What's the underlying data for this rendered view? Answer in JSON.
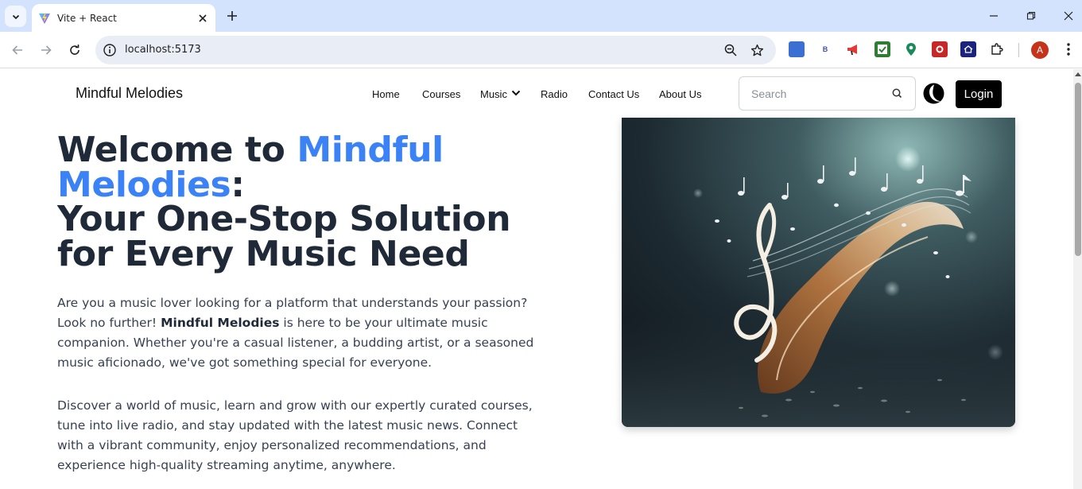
{
  "browser": {
    "tab_title": "Vite + React",
    "url": "localhost:5173",
    "profile_initial": "A",
    "extension_b_label": "B"
  },
  "site": {
    "brand": "Mindful Melodies",
    "nav": {
      "home": "Home",
      "courses": "Courses",
      "music": "Music",
      "radio": "Radio",
      "contact": "Contact Us",
      "about": "About Us"
    },
    "search_placeholder": "Search",
    "login_label": "Login"
  },
  "hero": {
    "title_prefix": "Welcome to ",
    "title_accent": "Mindful Melodies",
    "title_colon": ":",
    "title_line2": "Your One-Stop Solution for Every Music Need",
    "para1_a": "Are you a music lover looking for a platform that understands your passion? Look no further! ",
    "para1_bold": "Mindful Melodies",
    "para1_b": " is here to be your ultimate music companion. Whether you're a casual listener, a budding artist, or a seasoned music aficionado, we've got something special for everyone.",
    "para2": "Discover a world of music, learn and grow with our expertly curated courses, tune into live radio, and stay updated with the latest music news. Connect with a vibrant community, enjoy personalized recommendations, and experience high-quality streaming anytime, anywhere."
  },
  "colors": {
    "accent": "#3b82f6",
    "heading": "#1f2937",
    "body_text": "#374151",
    "login_bg": "#000000",
    "tabbar_bg": "#d3e3fd"
  }
}
